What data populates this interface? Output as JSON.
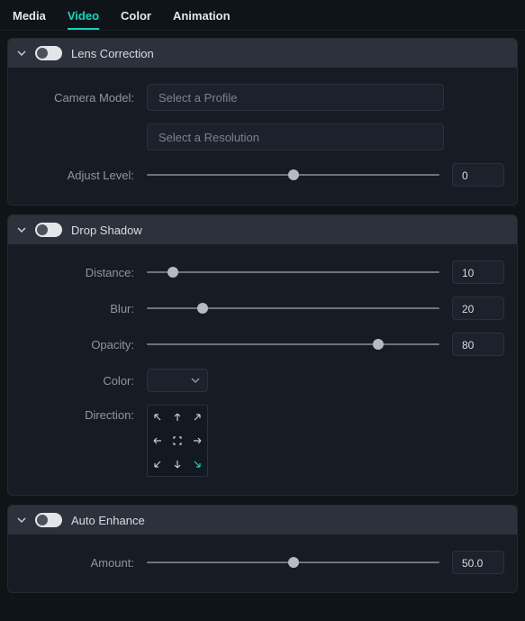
{
  "tabs": {
    "media": "Media",
    "video": "Video",
    "color": "Color",
    "animation": "Animation",
    "active": "video"
  },
  "lens": {
    "title": "Lens Correction",
    "camera_model_label": "Camera Model:",
    "profile_placeholder": "Select a Profile",
    "resolution_placeholder": "Select a Resolution",
    "adjust_label": "Adjust Level:",
    "adjust_value": "0",
    "adjust_pct": 50
  },
  "shadow": {
    "title": "Drop Shadow",
    "distance_label": "Distance:",
    "distance_value": "10",
    "distance_pct": 9,
    "blur_label": "Blur:",
    "blur_value": "20",
    "blur_pct": 19,
    "opacity_label": "Opacity:",
    "opacity_value": "80",
    "opacity_pct": 79,
    "color_label": "Color:",
    "direction_label": "Direction:",
    "direction_active": "se"
  },
  "enhance": {
    "title": "Auto Enhance",
    "amount_label": "Amount:",
    "amount_value": "50.0",
    "amount_pct": 50
  }
}
